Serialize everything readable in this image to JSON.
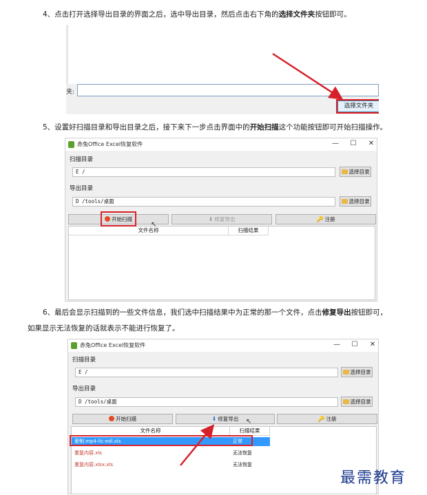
{
  "steps": {
    "step4": {
      "prefix": "4、点击打开选择导出目录的界面之后，选中导出目录，然后点击右下角的",
      "bold": "选择文件夹",
      "suffix": "按钮即可。"
    },
    "step5": {
      "prefix": "5、设置好扫描目录和导出目录之后，接下来下一步点击界面中的",
      "bold": "开始扫描",
      "suffix": "这个功能按钮即可开始扫描操作。"
    },
    "step6": {
      "line1_prefix": "6、最后会显示扫描到的一些文件信息，我们选中扫描结果中为正常的那一个文件，点击",
      "line1_bold": "修复导出",
      "line1_suffix": "按钮即可，",
      "line2": "如果显示无法恢复的话就表示不能进行恢复了。"
    }
  },
  "shot1": {
    "field_label": "夹:",
    "select_folder_button": "选择文件夹"
  },
  "app": {
    "title": "赤兔Office Excel恢复软件",
    "window_controls": [
      "—",
      "☐",
      "✕"
    ],
    "scan_dir_label": "扫描目录",
    "scan_dir_value": "E /",
    "choose_dir_button": "选择目录",
    "export_dir_label": "导出目录",
    "export_dir_value": "D /tools/桌面",
    "start_scan_button": "开始扫描",
    "repair_export_button": "修复导出",
    "register_button": "注册",
    "col_filename": "文件名称",
    "col_result": "扫描结果"
  },
  "results": [
    {
      "name": "爱制.mp4-llc-edl.xls",
      "status": "正常",
      "selected": true
    },
    {
      "name": "重复内容.xls",
      "status": "无法恢复",
      "selected": false
    },
    {
      "name": "重复内容.xlsx.xls",
      "status": "无法恢复",
      "selected": false
    }
  ],
  "icons": {
    "app": "app-icon",
    "folder": "folder-icon",
    "start": "play-circle-icon",
    "export": "arrow-down-icon",
    "register": "key-icon"
  },
  "watermark": "最需教育",
  "colors": {
    "highlight_red": "#d6202a",
    "selection_blue": "#3399ff",
    "watermark_blue": "#1b3a8f"
  }
}
